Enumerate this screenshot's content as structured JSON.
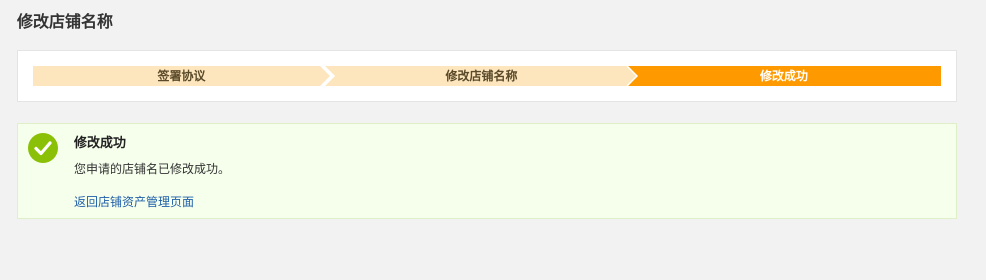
{
  "page": {
    "title": "修改店铺名称"
  },
  "steps": [
    {
      "label": "签署协议",
      "state": "done"
    },
    {
      "label": "修改店铺名称",
      "state": "done"
    },
    {
      "label": "修改成功",
      "state": "active"
    }
  ],
  "success": {
    "title": "修改成功",
    "description": "您申请的店铺名已修改成功。",
    "link_label": "返回店铺资产管理页面",
    "icon": "check-circle-icon"
  },
  "colors": {
    "step_inactive": "#fde6bd",
    "step_active": "#ff9900",
    "success_bg": "#f6ffec",
    "check_green": "#8ac007",
    "link": "#1f5fa8"
  }
}
